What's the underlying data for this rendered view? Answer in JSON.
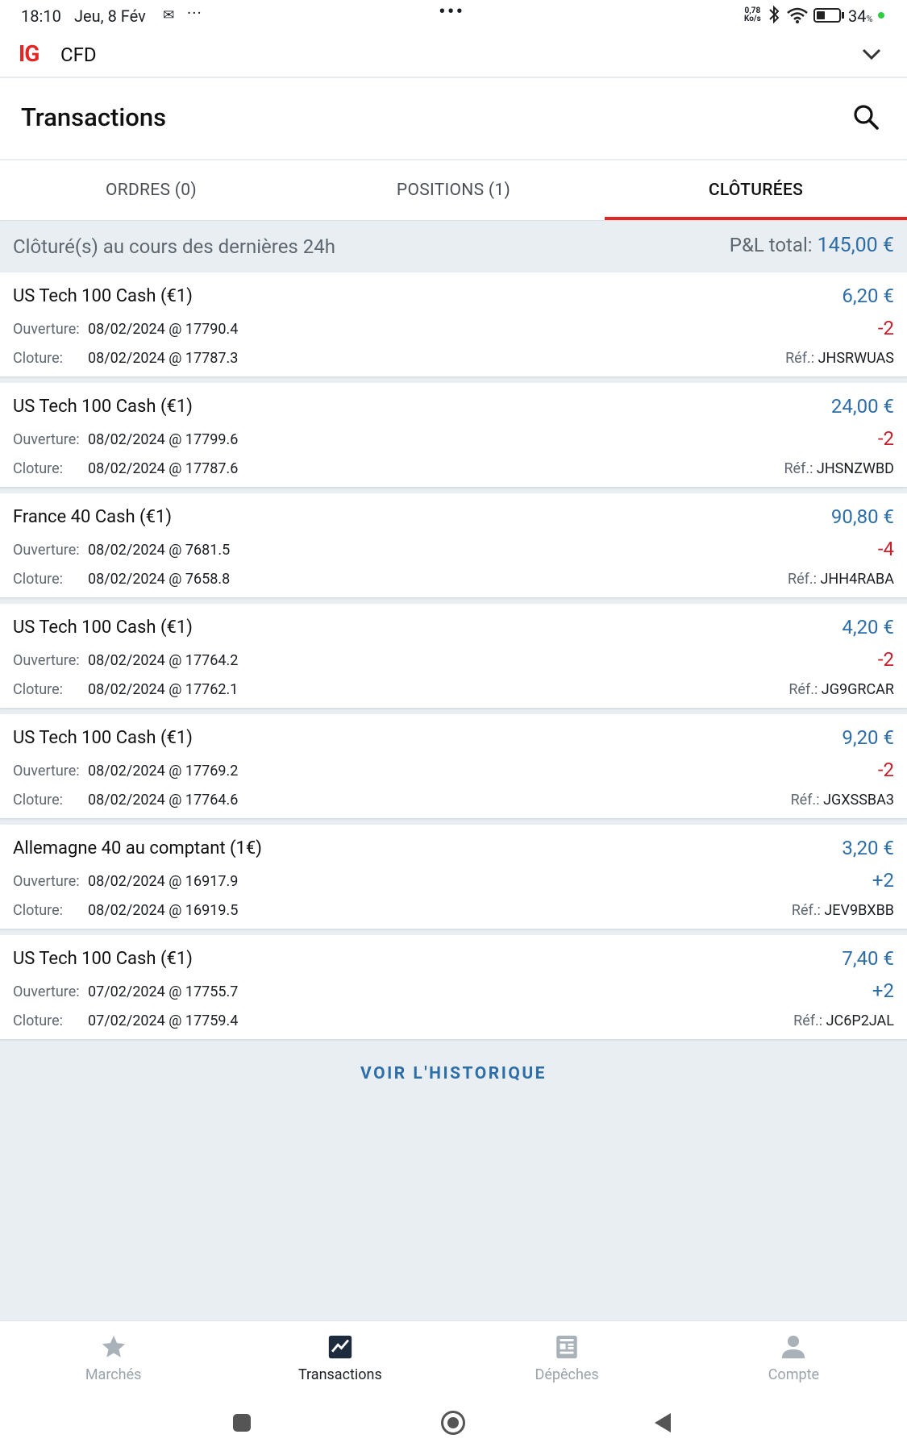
{
  "status_bar": {
    "time": "18:10",
    "date": "Jeu, 8 Fév",
    "network_speed_value": "0,78",
    "network_speed_unit": "Ko/s",
    "battery_percent": "34",
    "battery_unit": "%"
  },
  "app": {
    "logo": "IG",
    "account_type": "CFD"
  },
  "header": {
    "title": "Transactions"
  },
  "tabs": [
    {
      "label": "ORDRES (0)",
      "active": false
    },
    {
      "label": "POSITIONS (1)",
      "active": false
    },
    {
      "label": "CLÔTURÉES",
      "active": true
    }
  ],
  "summary": {
    "label": "Clôturé(s) au cours des dernières 24h",
    "pl_label": "P&L total:",
    "pl_value": "145,00 €"
  },
  "labels": {
    "open": "Ouverture:",
    "close": "Cloture:",
    "ref": "Réf.:"
  },
  "trades": [
    {
      "name": "US Tech 100 Cash (€1)",
      "open": "08/02/2024 @ 17790.4",
      "close": "08/02/2024 @ 17787.3",
      "pl": "6,20 €",
      "size": "-2",
      "ref": "JHSRWUAS"
    },
    {
      "name": "US Tech 100 Cash (€1)",
      "open": "08/02/2024 @ 17799.6",
      "close": "08/02/2024 @ 17787.6",
      "pl": "24,00 €",
      "size": "-2",
      "ref": "JHSNZWBD"
    },
    {
      "name": "France 40 Cash (€1)",
      "open": "08/02/2024 @ 7681.5",
      "close": "08/02/2024 @ 7658.8",
      "pl": "90,80 €",
      "size": "-4",
      "ref": "JHH4RABA"
    },
    {
      "name": "US Tech 100 Cash (€1)",
      "open": "08/02/2024 @ 17764.2",
      "close": "08/02/2024 @ 17762.1",
      "pl": "4,20 €",
      "size": "-2",
      "ref": "JG9GRCAR"
    },
    {
      "name": "US Tech 100 Cash (€1)",
      "open": "08/02/2024 @ 17769.2",
      "close": "08/02/2024 @ 17764.6",
      "pl": "9,20 €",
      "size": "-2",
      "ref": "JGXSSBA3"
    },
    {
      "name": "Allemagne 40 au comptant (1€)",
      "open": "08/02/2024 @ 16917.9",
      "close": "08/02/2024 @ 16919.5",
      "pl": "3,20 €",
      "size": "+2",
      "ref": "JEV9BXBB"
    },
    {
      "name": "US Tech 100 Cash (€1)",
      "open": "07/02/2024 @ 17755.7",
      "close": "07/02/2024 @ 17759.4",
      "pl": "7,40 €",
      "size": "+2",
      "ref": "JC6P2JAL"
    }
  ],
  "history_link": "VOIR L'HISTORIQUE",
  "bottom_nav": [
    {
      "label": "Marchés",
      "icon": "star-icon",
      "active": false
    },
    {
      "label": "Transactions",
      "icon": "chart-icon",
      "active": true
    },
    {
      "label": "Dépêches",
      "icon": "news-icon",
      "active": false
    },
    {
      "label": "Compte",
      "icon": "person-icon",
      "active": false
    }
  ],
  "colors": {
    "brand_red": "#e42523",
    "accent_blue": "#2e6ea8",
    "negative_red": "#c8202a",
    "background": "#e8eef2"
  }
}
